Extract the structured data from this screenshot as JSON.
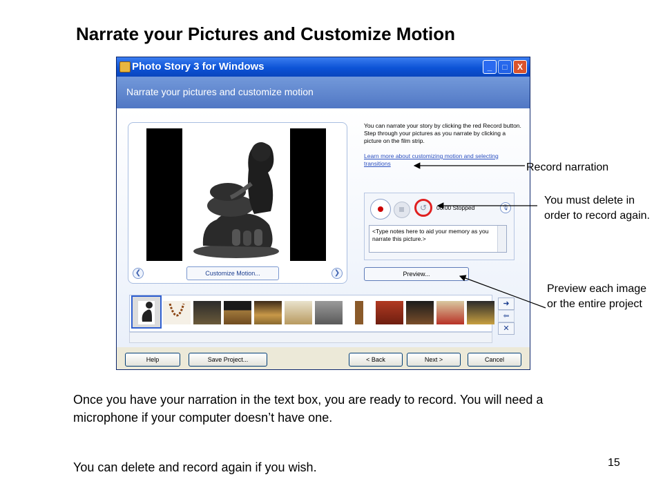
{
  "slide": {
    "title": "Narrate your Pictures and Customize Motion",
    "body_paragraphs": [
      "Once you have your narration in the text box, you are ready to record. You will need a microphone if your computer doesn’t have one.",
      "You can delete and record again if you wish."
    ],
    "page_number": "15"
  },
  "window": {
    "title": "Photo Story 3 for Windows",
    "header_title": "Narrate your pictures and customize motion",
    "instructions": "You can narrate your story by clicking the red Record button. Step through your pictures as you narrate by clicking a picture on the film strip.",
    "learn_link": "Learn more about customizing motion and selecting transitions",
    "customize_button": "Customize Motion...",
    "status": "00:00  Stopped",
    "notes_placeholder": "<Type notes here to aid your memory as you narrate this picture.>",
    "preview_button": "Preview...",
    "footer_buttons": {
      "help": "Help",
      "save": "Save Project...",
      "back": "< Back",
      "next": "Next >",
      "cancel": "Cancel"
    },
    "controls": {
      "minimize_icon": "_",
      "maximize_icon": "□",
      "close_icon": "X",
      "move_right_icon": "➜",
      "move_left_icon": "⬅",
      "remove_icon": "✕"
    }
  },
  "annotations": {
    "record": "Record narration",
    "delete": "You must delete in order to record again.",
    "preview": "Preview each image or the entire project"
  },
  "colors": {
    "titlebar": "#0c53d6",
    "header": "#5f86cf",
    "record_red": "#cc0000",
    "highlight_red": "#e02020"
  }
}
